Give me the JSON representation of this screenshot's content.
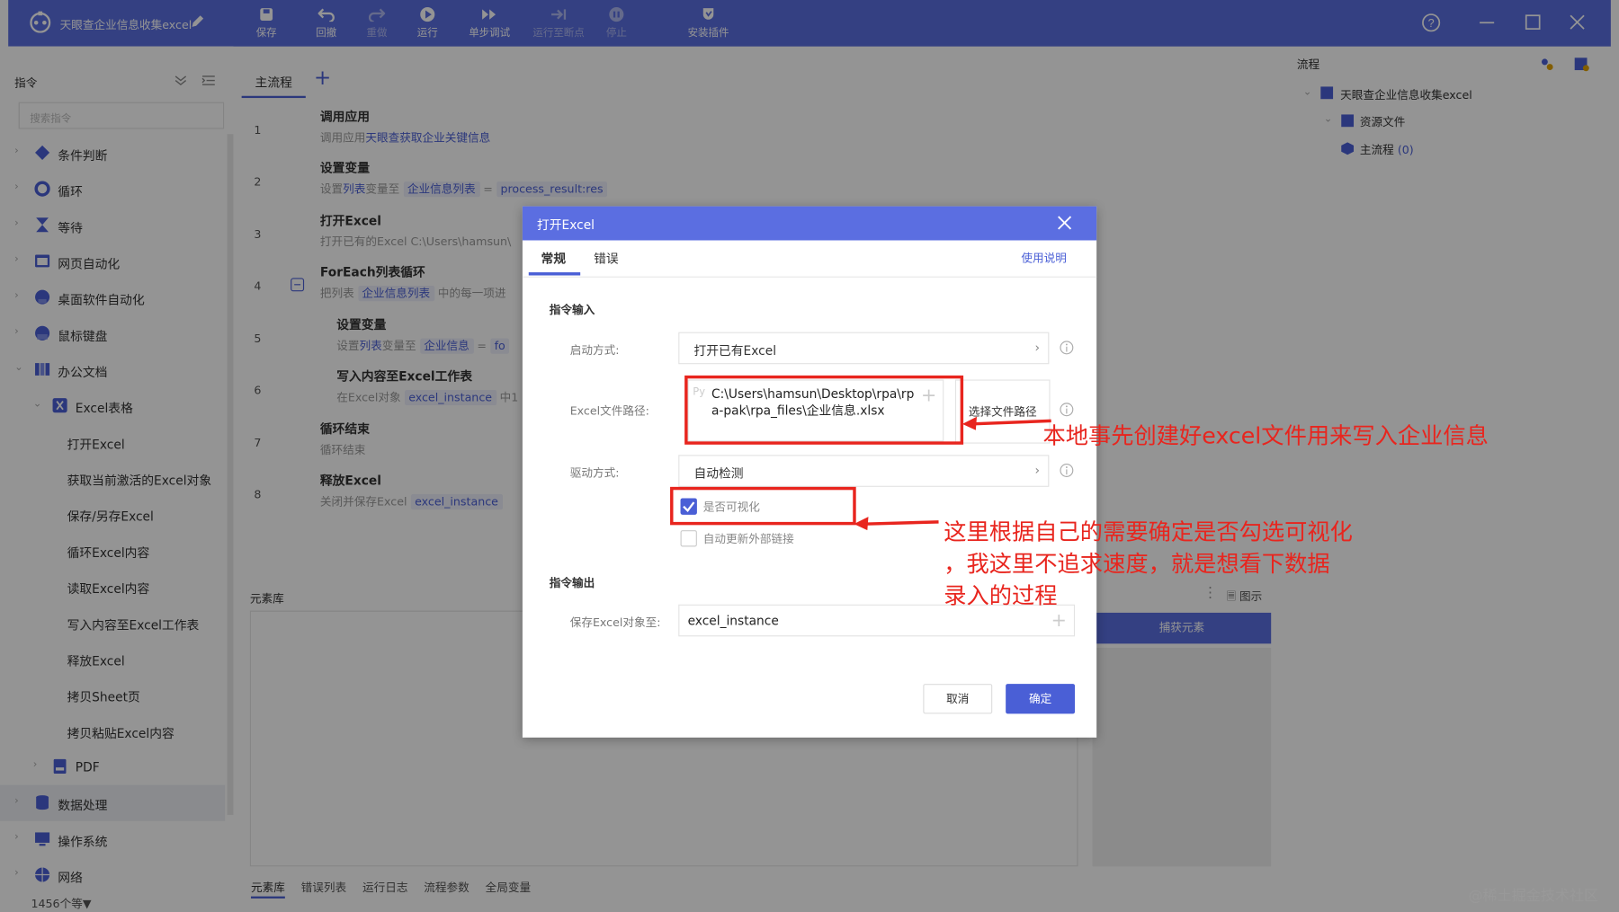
{
  "app": {
    "title": "天眼查企业信息收集excel",
    "toolbar": [
      {
        "label": "保存",
        "icon": "save-icon",
        "enabled": true
      },
      {
        "label": "回撤",
        "icon": "undo-icon",
        "enabled": true
      },
      {
        "label": "重做",
        "icon": "redo-icon",
        "enabled": false
      },
      {
        "label": "运行",
        "icon": "play-icon",
        "enabled": true
      },
      {
        "label": "单步调试",
        "icon": "step-debug-icon",
        "enabled": true
      },
      {
        "label": "运行至断点",
        "icon": "run-to-breakpoint-icon",
        "enabled": false
      },
      {
        "label": "停止",
        "icon": "stop-icon",
        "enabled": false
      },
      {
        "label": "安装插件",
        "icon": "plugin-icon",
        "enabled": true
      }
    ],
    "accent": "#5b6ee1"
  },
  "left": {
    "title": "指令",
    "search_placeholder": "搜索指令",
    "items": [
      {
        "label": "条件判断",
        "icon": "condition-icon",
        "level": 0
      },
      {
        "label": "循环",
        "icon": "loop-icon",
        "level": 0
      },
      {
        "label": "等待",
        "icon": "hourglass-icon",
        "level": 0
      },
      {
        "label": "网页自动化",
        "icon": "web-icon",
        "level": 0
      },
      {
        "label": "桌面软件自动化",
        "icon": "desktop-icon",
        "level": 0
      },
      {
        "label": "鼠标键盘",
        "icon": "mouse-keyboard-icon",
        "level": 0
      },
      {
        "label": "办公文档",
        "icon": "office-icon",
        "level": 0
      },
      {
        "label": "Excel表格",
        "icon": "excel-icon",
        "level": 1
      },
      {
        "label": "打开Excel",
        "level": 2
      },
      {
        "label": "获取当前激活的Excel对象",
        "level": 2
      },
      {
        "label": "保存/另存Excel",
        "level": 2
      },
      {
        "label": "循环Excel内容",
        "level": 2
      },
      {
        "label": "读取Excel内容",
        "level": 2
      },
      {
        "label": "写入内容至Excel工作表",
        "level": 2
      },
      {
        "label": "释放Excel",
        "level": 2
      },
      {
        "label": "拷贝Sheet页",
        "level": 2
      },
      {
        "label": "拷贝粘贴Excel内容",
        "level": 2
      },
      {
        "label": "PDF",
        "icon": "pdf-icon",
        "level": 1
      },
      {
        "label": "数据处理",
        "icon": "database-icon",
        "level": 0
      },
      {
        "label": "操作系统",
        "icon": "os-icon",
        "level": 0
      },
      {
        "label": "网络",
        "icon": "globe-icon",
        "level": 0
      }
    ]
  },
  "center": {
    "tab": "主流程",
    "steps": [
      {
        "num": "1",
        "title": "调用应用",
        "desc_prefix": "调用应用",
        "desc_link": "天眼查获取企业关键信息"
      },
      {
        "num": "2",
        "title": "设置变量",
        "desc": "设置",
        "desc_link": "列表",
        "desc_mid": "变量至",
        "pill1": "企业信息列表",
        "eq": "=",
        "pill2": "process_result:res"
      },
      {
        "num": "3",
        "title": "打开Excel",
        "desc_link": "打开已有的Excel C:\\Users\\hamsun\\"
      },
      {
        "num": "4",
        "title": "ForEach列表循环",
        "desc": "把列表",
        "pill1": "企业信息列表",
        "desc_tail": "中的每一项进"
      },
      {
        "num": "5",
        "title": "设置变量",
        "desc": "设置",
        "desc_link": "列表",
        "desc_mid": "变量至",
        "pill1": "企业信息",
        "eq": "=",
        "pill2": "fo"
      },
      {
        "num": "6",
        "title": "写入内容至Excel工作表",
        "desc": "在Excel对象",
        "pill1": "excel_instance",
        "desc_tail": "中1"
      },
      {
        "num": "7",
        "title": "循环结束",
        "desc": "循环结束"
      },
      {
        "num": "8",
        "title": "释放Excel",
        "desc": "关闭并保存Excel",
        "pill1": "excel_instance"
      }
    ],
    "library_title": "元素库",
    "show_label": "图示",
    "capture_label": "捕获元素",
    "bottom_tabs": [
      "元素库",
      "错误列表",
      "运行日志",
      "流程参数",
      "全局变量"
    ],
    "status": "1456个等▼"
  },
  "right": {
    "title": "流程",
    "tree": {
      "root": "天眼查企业信息收集excel",
      "resources": "资源文件",
      "main_flow": "主流程",
      "main_count": "(0)"
    }
  },
  "dialog": {
    "title": "打开Excel",
    "tabs": [
      "常规",
      "错误"
    ],
    "help": "使用说明",
    "input_section": "指令输入",
    "start_label": "启动方式:",
    "start_value": "打开已有Excel",
    "path_label": "Excel文件路径:",
    "path_prefix": "Py",
    "path_value": "C:\\Users\\hamsun\\Desktop\\rpa\\rpa-pak\\rpa_files\\企业信息.xlsx",
    "choose_label": "选择文件路径",
    "driver_label": "驱动方式:",
    "driver_value": "自动检测",
    "visible_label": "是否可视化",
    "visible_checked": true,
    "autoupdate_label": "自动更新外部链接",
    "autoupdate_checked": false,
    "output_section": "指令输出",
    "save_label": "保存Excel对象至:",
    "save_value": "excel_instance",
    "cancel": "取消",
    "ok": "确定"
  },
  "annotations": {
    "note1": "本地事先创建好excel文件用来写入企业信息",
    "note2_line1": "这里根据自己的需要确定是否勾选可视化",
    "note2_line2": "，我这里不追求速度，就是想看下数据",
    "note2_line3": "录入的过程",
    "color": "#e8251e"
  },
  "watermark": "@稀土掘金技术社区"
}
